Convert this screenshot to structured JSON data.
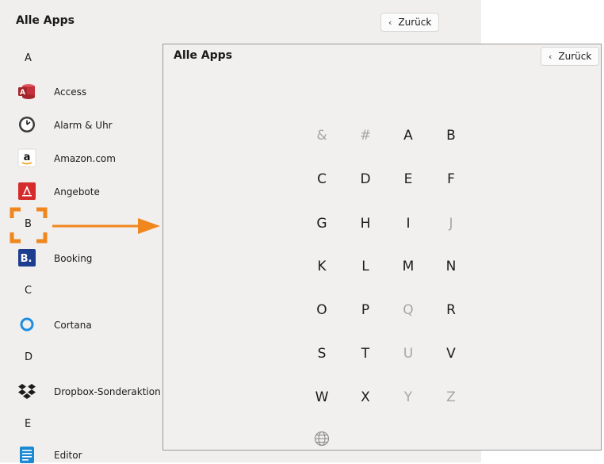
{
  "background_view": {
    "title": "Alle Apps",
    "back_label": "Zurück",
    "items": [
      {
        "type": "header",
        "label": "A"
      },
      {
        "type": "app",
        "label": "Access",
        "icon": "access-icon"
      },
      {
        "type": "app",
        "label": "Alarm & Uhr",
        "icon": "alarm-clock-icon"
      },
      {
        "type": "app",
        "label": "Amazon.com",
        "icon": "amazon-icon"
      },
      {
        "type": "app",
        "label": "Angebote",
        "icon": "offers-icon"
      },
      {
        "type": "header",
        "label": "B"
      },
      {
        "type": "app",
        "label": "Booking",
        "icon": "booking-icon"
      },
      {
        "type": "header",
        "label": "C"
      },
      {
        "type": "app",
        "label": "Cortana",
        "icon": "cortana-icon"
      },
      {
        "type": "header",
        "label": "D"
      },
      {
        "type": "app",
        "label": "Dropbox-Sonderaktion",
        "icon": "dropbox-icon"
      },
      {
        "type": "header",
        "label": "E"
      },
      {
        "type": "app",
        "label": "Editor",
        "icon": "notepad-icon"
      }
    ]
  },
  "alphabet_view": {
    "title": "Alle Apps",
    "back_label": "Zurück",
    "letters": [
      {
        "label": "&",
        "enabled": false
      },
      {
        "label": "#",
        "enabled": false
      },
      {
        "label": "A",
        "enabled": true
      },
      {
        "label": "B",
        "enabled": true
      },
      {
        "label": "C",
        "enabled": true
      },
      {
        "label": "D",
        "enabled": true
      },
      {
        "label": "E",
        "enabled": true
      },
      {
        "label": "F",
        "enabled": true
      },
      {
        "label": "G",
        "enabled": true
      },
      {
        "label": "H",
        "enabled": true
      },
      {
        "label": "I",
        "enabled": true
      },
      {
        "label": "J",
        "enabled": false
      },
      {
        "label": "K",
        "enabled": true
      },
      {
        "label": "L",
        "enabled": true
      },
      {
        "label": "M",
        "enabled": true
      },
      {
        "label": "N",
        "enabled": true
      },
      {
        "label": "O",
        "enabled": true
      },
      {
        "label": "P",
        "enabled": true
      },
      {
        "label": "Q",
        "enabled": false
      },
      {
        "label": "R",
        "enabled": true
      },
      {
        "label": "S",
        "enabled": true
      },
      {
        "label": "T",
        "enabled": true
      },
      {
        "label": "U",
        "enabled": false
      },
      {
        "label": "V",
        "enabled": true
      },
      {
        "label": "W",
        "enabled": true
      },
      {
        "label": "X",
        "enabled": true
      },
      {
        "label": "Y",
        "enabled": false
      },
      {
        "label": "Z",
        "enabled": false
      },
      {
        "label": "",
        "enabled": false,
        "icon": "globe-icon"
      }
    ]
  },
  "annotation": {
    "highlight_color": "#f0861e",
    "highlight_target": "B",
    "arrow_icon": "arrow-right-icon"
  }
}
